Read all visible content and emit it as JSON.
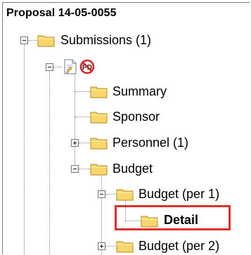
{
  "tree": {
    "title": "Proposal 14-05-0055",
    "nodes": {
      "submissions": "Submissions (1)",
      "summary": "Summary",
      "sponsor": "Sponsor",
      "personnel": "Personnel (1)",
      "budget": "Budget",
      "budget_per1": "Budget (per 1)",
      "detail": "Detail",
      "budget_per2": "Budget (per 2)"
    },
    "selected": "Detail"
  },
  "icons": {
    "folder": "folder-icon",
    "document": "document-icon",
    "pd_prohibited": "no-pd-icon",
    "expand": "expand-toggle-icon",
    "collapse": "collapse-toggle-icon"
  },
  "colors": {
    "folder_fill": "#f7d66b",
    "folder_stroke": "#b78b1c",
    "highlight": "#e0302b",
    "prohibited": "#d2232a"
  }
}
